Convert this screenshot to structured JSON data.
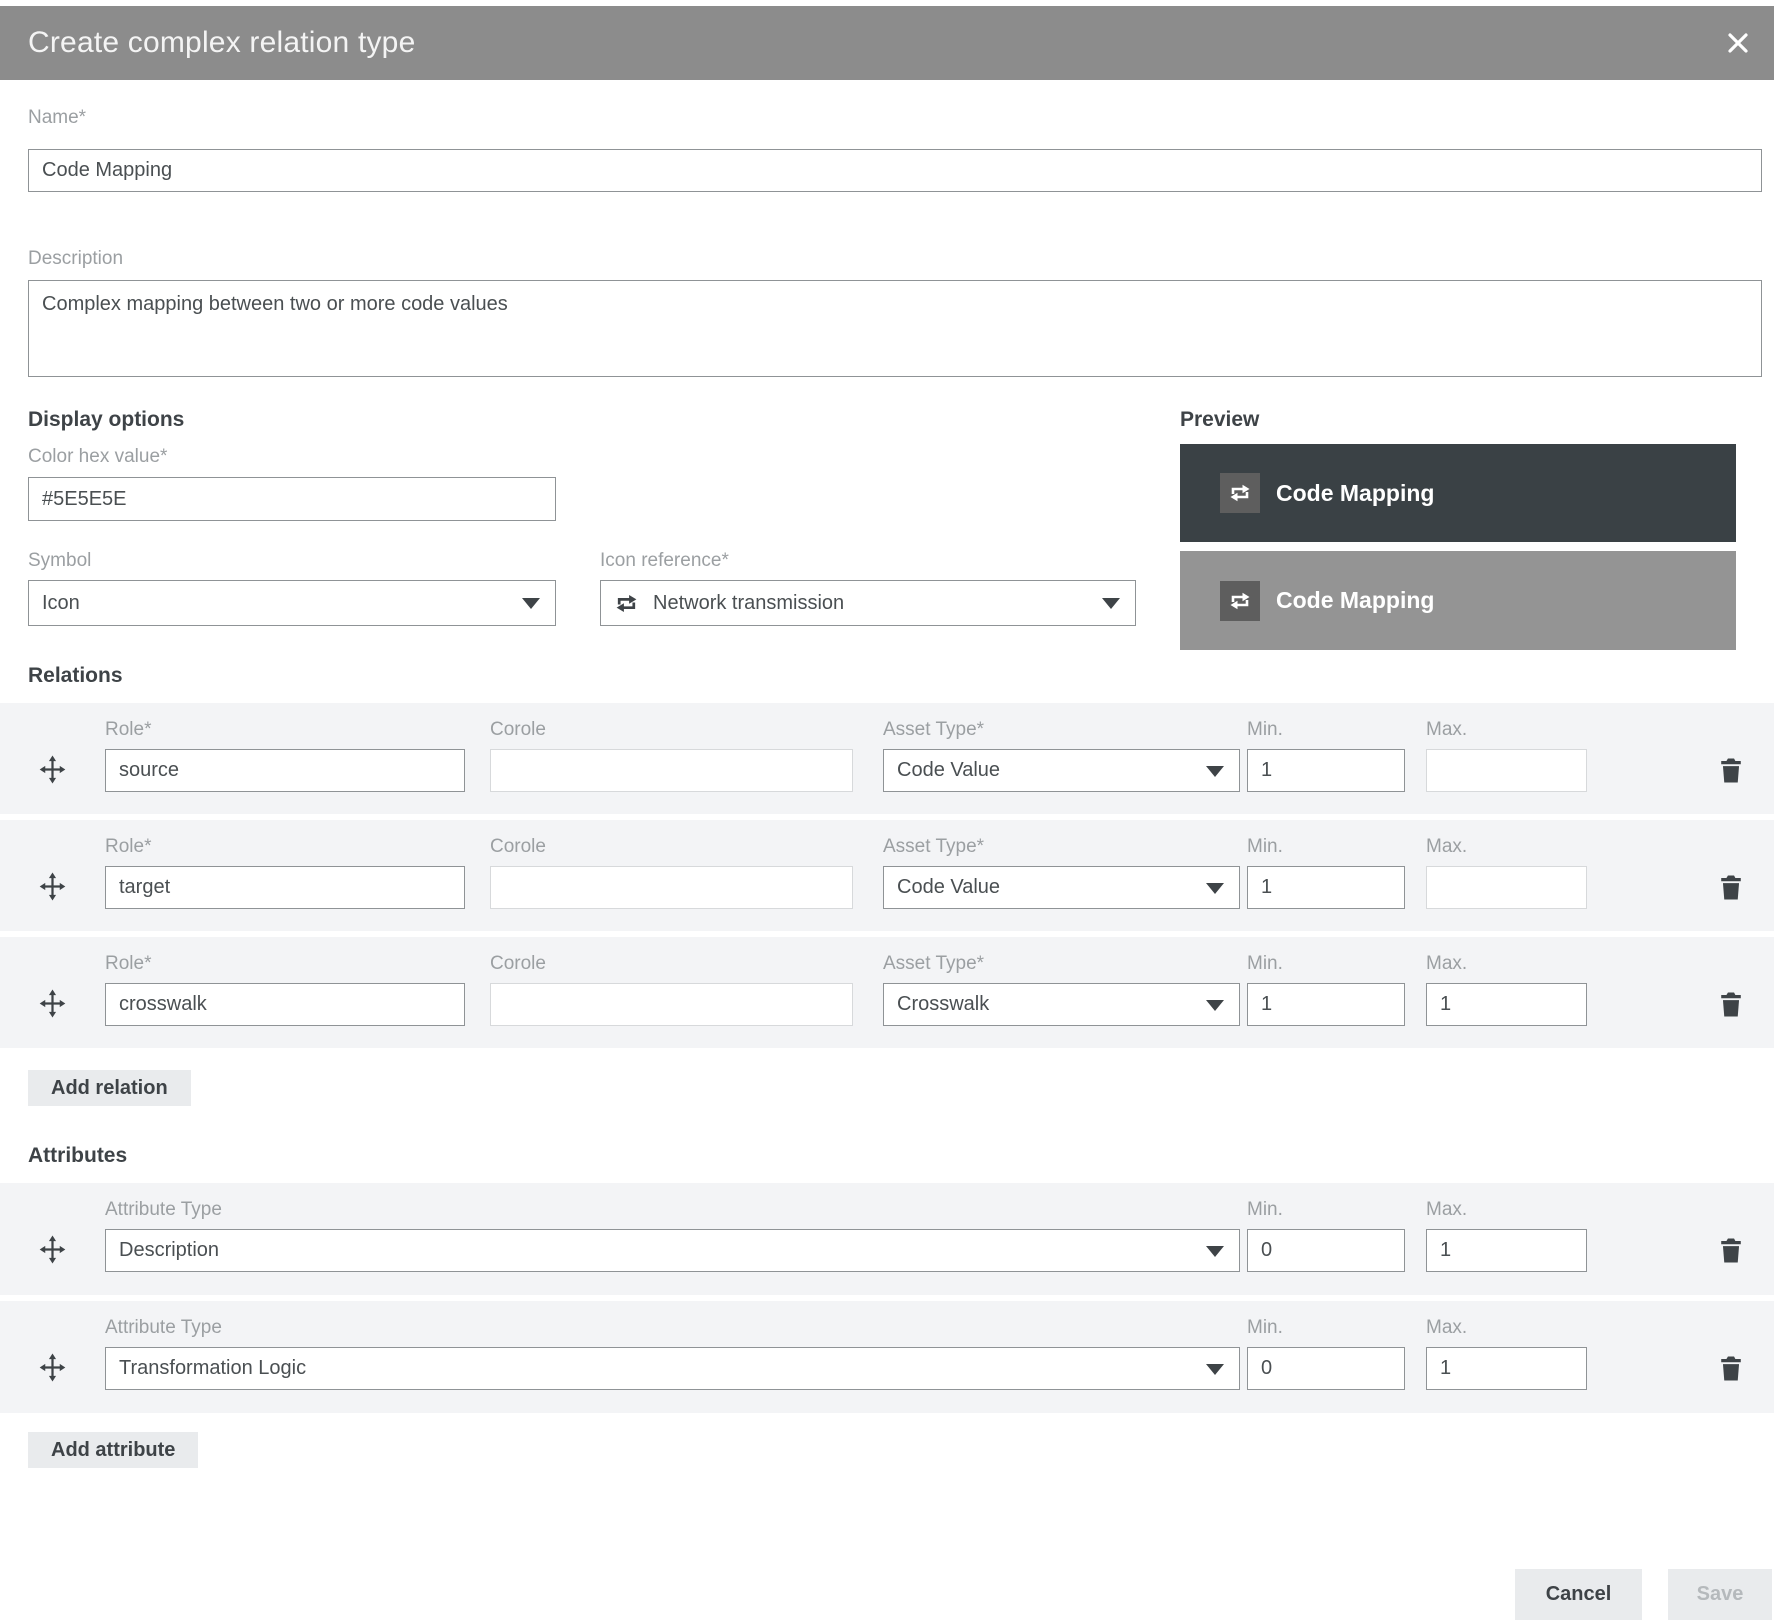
{
  "dialog": {
    "title": "Create complex relation type"
  },
  "fields": {
    "name": {
      "label": "Name*",
      "value": "Code Mapping"
    },
    "description": {
      "label": "Description",
      "value": "Complex mapping between two or more code values"
    }
  },
  "display_options": {
    "heading": "Display options",
    "color": {
      "label": "Color hex value*",
      "value": "#5E5E5E"
    },
    "symbol": {
      "label": "Symbol",
      "value": "Icon"
    },
    "icon_reference": {
      "label": "Icon reference*",
      "value": "Network transmission",
      "icon": "network-transmission-icon"
    }
  },
  "preview": {
    "heading": "Preview",
    "cards": [
      {
        "label": "Code Mapping",
        "bg": "#3A4145",
        "chip_color": "#5E5E5E",
        "icon": "network-transmission-icon"
      },
      {
        "label": "Code Mapping",
        "bg": "#949494",
        "chip_color": "#5E5E5E",
        "icon": "network-transmission-icon"
      }
    ]
  },
  "relations": {
    "heading": "Relations",
    "labels": {
      "role": "Role*",
      "corole": "Corole",
      "asset_type": "Asset Type*",
      "min": "Min.",
      "max": "Max."
    },
    "rows": [
      {
        "role": "source",
        "corole": "",
        "asset_type": "Code Value",
        "min": "1",
        "max": ""
      },
      {
        "role": "target",
        "corole": "",
        "asset_type": "Code Value",
        "min": "1",
        "max": ""
      },
      {
        "role": "crosswalk",
        "corole": "",
        "asset_type": "Crosswalk",
        "min": "1",
        "max": "1"
      }
    ],
    "add_button": "Add relation"
  },
  "attributes": {
    "heading": "Attributes",
    "labels": {
      "attribute_type": "Attribute Type",
      "min": "Min.",
      "max": "Max."
    },
    "rows": [
      {
        "attribute_type": "Description",
        "min": "0",
        "max": "1"
      },
      {
        "attribute_type": "Transformation Logic",
        "min": "0",
        "max": "1"
      }
    ],
    "add_button": "Add attribute"
  },
  "footer": {
    "cancel": "Cancel",
    "save": "Save"
  }
}
